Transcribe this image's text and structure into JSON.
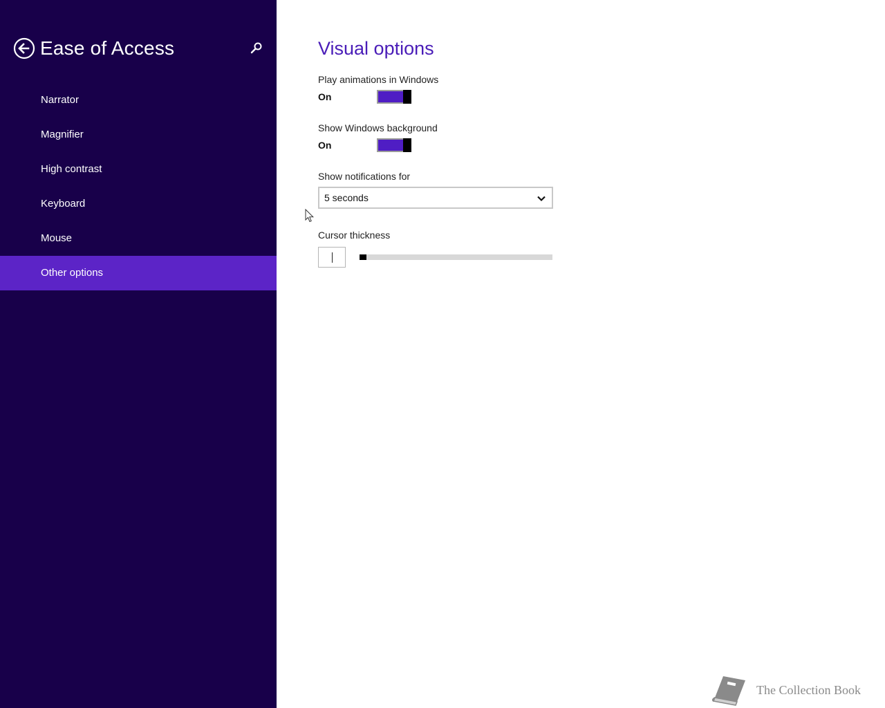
{
  "sidebar": {
    "title": "Ease of Access",
    "back_icon": "back-arrow-circle-icon",
    "search_icon": "search-icon",
    "items": [
      {
        "label": "Narrator",
        "selected": false
      },
      {
        "label": "Magnifier",
        "selected": false
      },
      {
        "label": "High contrast",
        "selected": false
      },
      {
        "label": "Keyboard",
        "selected": false
      },
      {
        "label": "Mouse",
        "selected": false
      },
      {
        "label": "Other options",
        "selected": true
      }
    ]
  },
  "main": {
    "title": "Visual options",
    "animations": {
      "label": "Play animations in Windows",
      "state": "On"
    },
    "background": {
      "label": "Show Windows background",
      "state": "On"
    },
    "notifications": {
      "label": "Show notifications for",
      "value": "5 seconds"
    },
    "cursor_thickness": {
      "label": "Cursor thickness",
      "level": 0.0
    }
  },
  "watermark": {
    "text": "The Collection Book",
    "icon": "book-icon"
  },
  "colors": {
    "sidebar_bg": "#18004a",
    "selected_bg": "#5c24c7",
    "accent": "#4f1dc4",
    "title": "#4a1db8"
  }
}
